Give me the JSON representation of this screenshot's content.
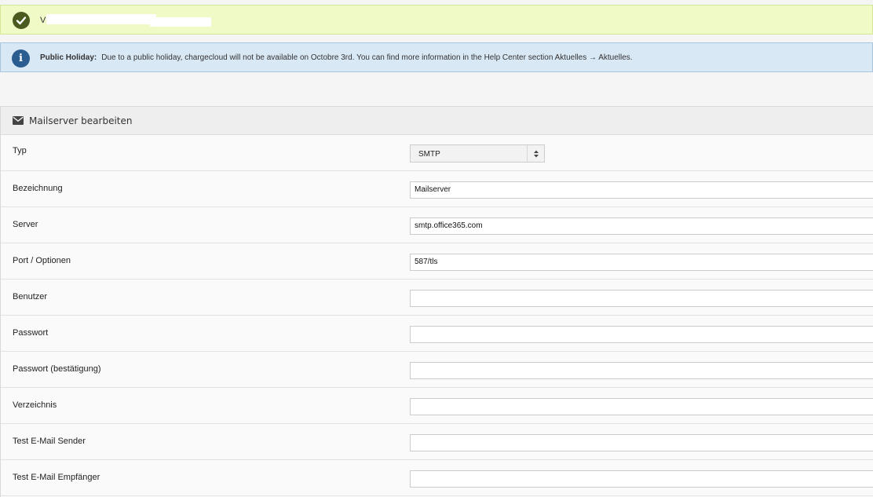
{
  "success_alert": {
    "message": "V"
  },
  "info_alert": {
    "title": "Public Holiday:",
    "message": "Due to a public holiday, chargecloud will not be available on Octobre 3rd. You can find more information in the Help Center section Aktuelles → Aktuelles."
  },
  "panel": {
    "title": "Mailserver bearbeiten"
  },
  "form": {
    "typ": {
      "label": "Typ",
      "value": "SMTP"
    },
    "bezeichnung": {
      "label": "Bezeichnung",
      "value": "Mailserver"
    },
    "server": {
      "label": "Server",
      "value": "smtp.office365.com"
    },
    "port": {
      "label": "Port / Optionen",
      "value": "587/tls"
    },
    "benutzer": {
      "label": "Benutzer",
      "value": ""
    },
    "passwort": {
      "label": "Passwort",
      "value": ""
    },
    "passwort_bestaetigung": {
      "label": "Passwort (bestätigung)",
      "value": ""
    },
    "verzeichnis": {
      "label": "Verzeichnis",
      "value": ""
    },
    "test_sender": {
      "label": "Test E-Mail Sender",
      "value": ""
    },
    "test_empfaenger": {
      "label": "Test E-Mail Empfänger",
      "value": ""
    }
  },
  "colors": {
    "success_bg": "#effac7",
    "success_icon": "#4b5a1e",
    "info_bg": "#d9e8f5",
    "info_icon": "#2b5d91"
  },
  "icons": {
    "success": "check-circle-icon",
    "info": "info-circle-icon",
    "panel": "envelope-icon",
    "select": "sort-arrows-icon"
  }
}
